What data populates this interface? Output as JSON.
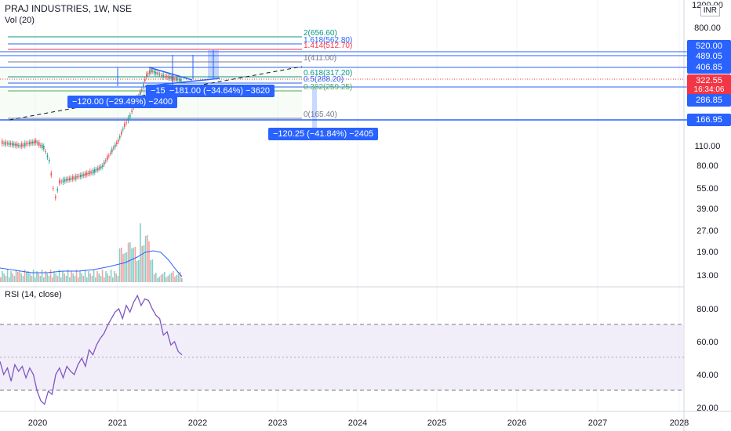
{
  "header": {
    "symbol_line": "PRAJ INDUSTRIES, 1W, NSE",
    "volume_label": "Vol (20)",
    "rsi_label": "RSI (14, close)",
    "currency": "INR"
  },
  "price_axis": {
    "ticks": [
      "1200.00",
      "800.00",
      "520.00",
      "489.05",
      "406.85",
      "322.55",
      "286.85",
      "166.95",
      "110.00",
      "80.00",
      "55.00",
      "39.00",
      "27.00",
      "19.00",
      "13.00"
    ],
    "current_price": "322.55",
    "countdown": "16:34:06"
  },
  "rsi_axis": {
    "ticks": [
      "80.00",
      "60.00",
      "40.00",
      "20.00"
    ],
    "upper": 70,
    "lower": 30,
    "mid": 50
  },
  "time_axis": {
    "labels": [
      "2020",
      "2021",
      "2022",
      "2023",
      "2024",
      "2025",
      "2026",
      "2027",
      "2028"
    ]
  },
  "fib_levels": [
    {
      "label": "2(656.60)",
      "color": "#089981"
    },
    {
      "label": "1.618(562.80)",
      "color": "#2962ff"
    },
    {
      "label": "1.414(512.70)",
      "color": "#f23645"
    },
    {
      "label": "1(411.00)",
      "color": "#787b86"
    },
    {
      "label": "0.618(317.20)",
      "color": "#089981"
    },
    {
      "label": "0.5(288.20)",
      "color": "#2962ff"
    },
    {
      "label": "0.382(259.25)",
      "color": "#4caf50"
    },
    {
      "label": "0(165.40)",
      "color": "#787b86"
    }
  ],
  "measurements": [
    {
      "text": "−120.00 (−29.49%) −2400"
    },
    {
      "text": "−15   −181.00 (−34.64%) −3620"
    },
    {
      "text": "−120.25 (−41.84%) −2405"
    }
  ],
  "colors": {
    "up": "#26a69a",
    "down": "#ef5350",
    "accent": "#2962ff",
    "rsi_line": "#7e57c2",
    "rsi_band": "#ede7f6",
    "grid": "#f0f3fa"
  },
  "chart_data": [
    {
      "type": "line",
      "title": "PRAJ INDUSTRIES, 1W, NSE",
      "ylabel": "INR",
      "scale": "log",
      "ylim": [
        11,
        1200
      ],
      "x": [
        "2020-01",
        "2020-03",
        "2020-05",
        "2020-07",
        "2020-09",
        "2020-11",
        "2021-01",
        "2021-03",
        "2021-05",
        "2021-07",
        "2021-09",
        "2021-10"
      ],
      "series": [
        {
          "values": [
            95,
            85,
            48,
            60,
            70,
            80,
            110,
            240,
            380,
            350,
            330,
            322.55
          ]
        }
      ]
    },
    {
      "type": "line",
      "title": "RSI (14, close)",
      "ylim": [
        15,
        95
      ],
      "x": [
        "2020-01",
        "2020-03",
        "2020-05",
        "2020-07",
        "2020-09",
        "2020-11",
        "2021-01",
        "2021-03",
        "2021-05",
        "2021-07",
        "2021-09",
        "2021-10"
      ],
      "series": [
        {
          "values": [
            48,
            40,
            24,
            45,
            40,
            55,
            70,
            80,
            88,
            80,
            60,
            52
          ]
        }
      ]
    }
  ]
}
